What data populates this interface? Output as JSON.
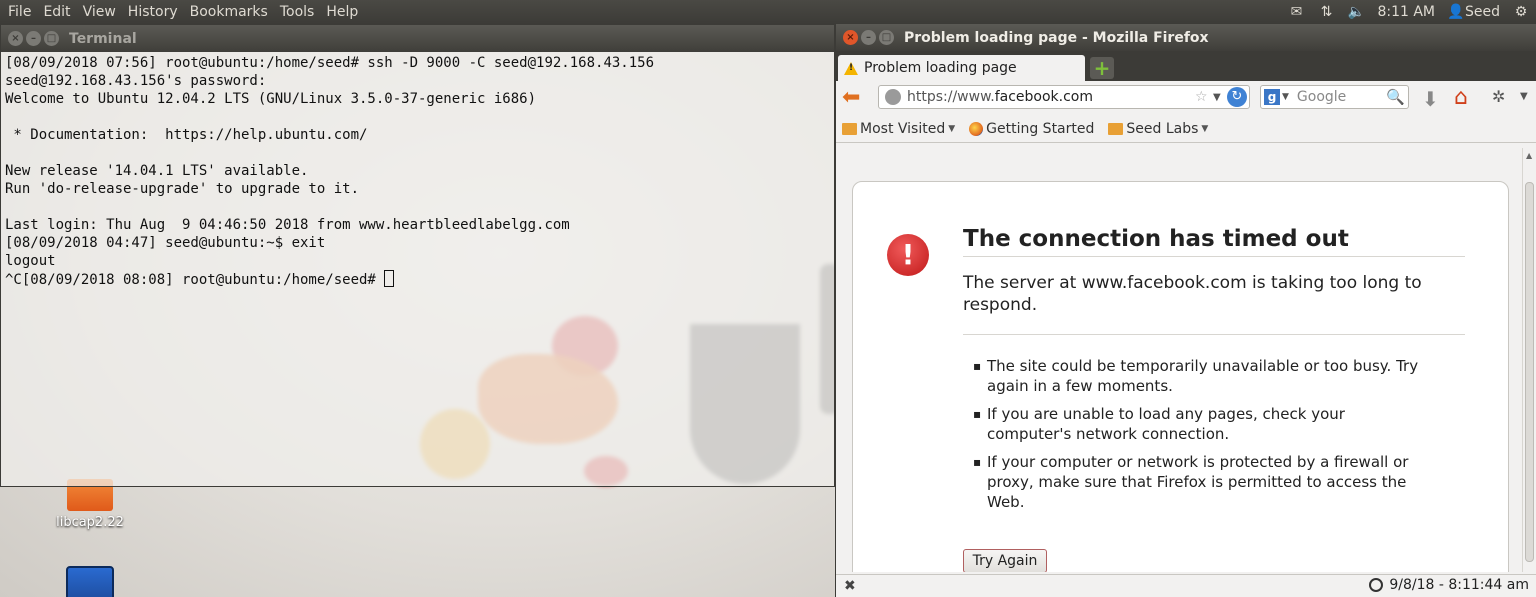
{
  "top_panel": {
    "menu": [
      "File",
      "Edit",
      "View",
      "History",
      "Bookmarks",
      "Tools",
      "Help"
    ],
    "time": "8:11 AM",
    "user": "Seed"
  },
  "desktop": {
    "icons": [
      {
        "label": "libcap2.22",
        "icon": "folder-icon"
      },
      {
        "label": "",
        "icon": "wireshark-icon"
      }
    ]
  },
  "terminal": {
    "title": "Terminal",
    "lines": [
      "[08/09/2018 07:56] root@ubuntu:/home/seed# ssh -D 9000 -C seed@192.168.43.156",
      "seed@192.168.43.156's password:",
      "Welcome to Ubuntu 12.04.2 LTS (GNU/Linux 3.5.0-37-generic i686)",
      "",
      " * Documentation:  https://help.ubuntu.com/",
      "",
      "New release '14.04.1 LTS' available.",
      "Run 'do-release-upgrade' to upgrade to it.",
      "",
      "Last login: Thu Aug  9 04:46:50 2018 from www.heartbleedlabelgg.com",
      "[08/09/2018 04:47] seed@ubuntu:~$ exit",
      "logout"
    ],
    "prompt_line": "^C[08/09/2018 08:08] root@ubuntu:/home/seed# "
  },
  "firefox": {
    "window_title": "Problem loading page - Mozilla Firefox",
    "tab_label": "Problem loading page",
    "url_prefix": "https://www.",
    "url_domain": "facebook.com",
    "search_placeholder": "Google",
    "bookmarks": [
      "Most Visited",
      "Getting Started",
      "Seed Labs"
    ],
    "error": {
      "title": "The connection has timed out",
      "description": "The server at www.facebook.com is taking too long to respond.",
      "bullets": [
        "The site could be temporarily unavailable or too busy. Try again in a few moments.",
        "If you are unable to load any pages, check your computer's network connection.",
        "If your computer or network is protected by a firewall or proxy, make sure that Firefox is permitted to access the Web."
      ],
      "try_again": "Try Again"
    },
    "status_time": "9/8/18 - 8:11:44 am"
  },
  "colors": {
    "panel_bg": "#3c3b37",
    "close_button": "#e0562a",
    "error_red": "#c01818",
    "back_arrow": "#e07020"
  }
}
